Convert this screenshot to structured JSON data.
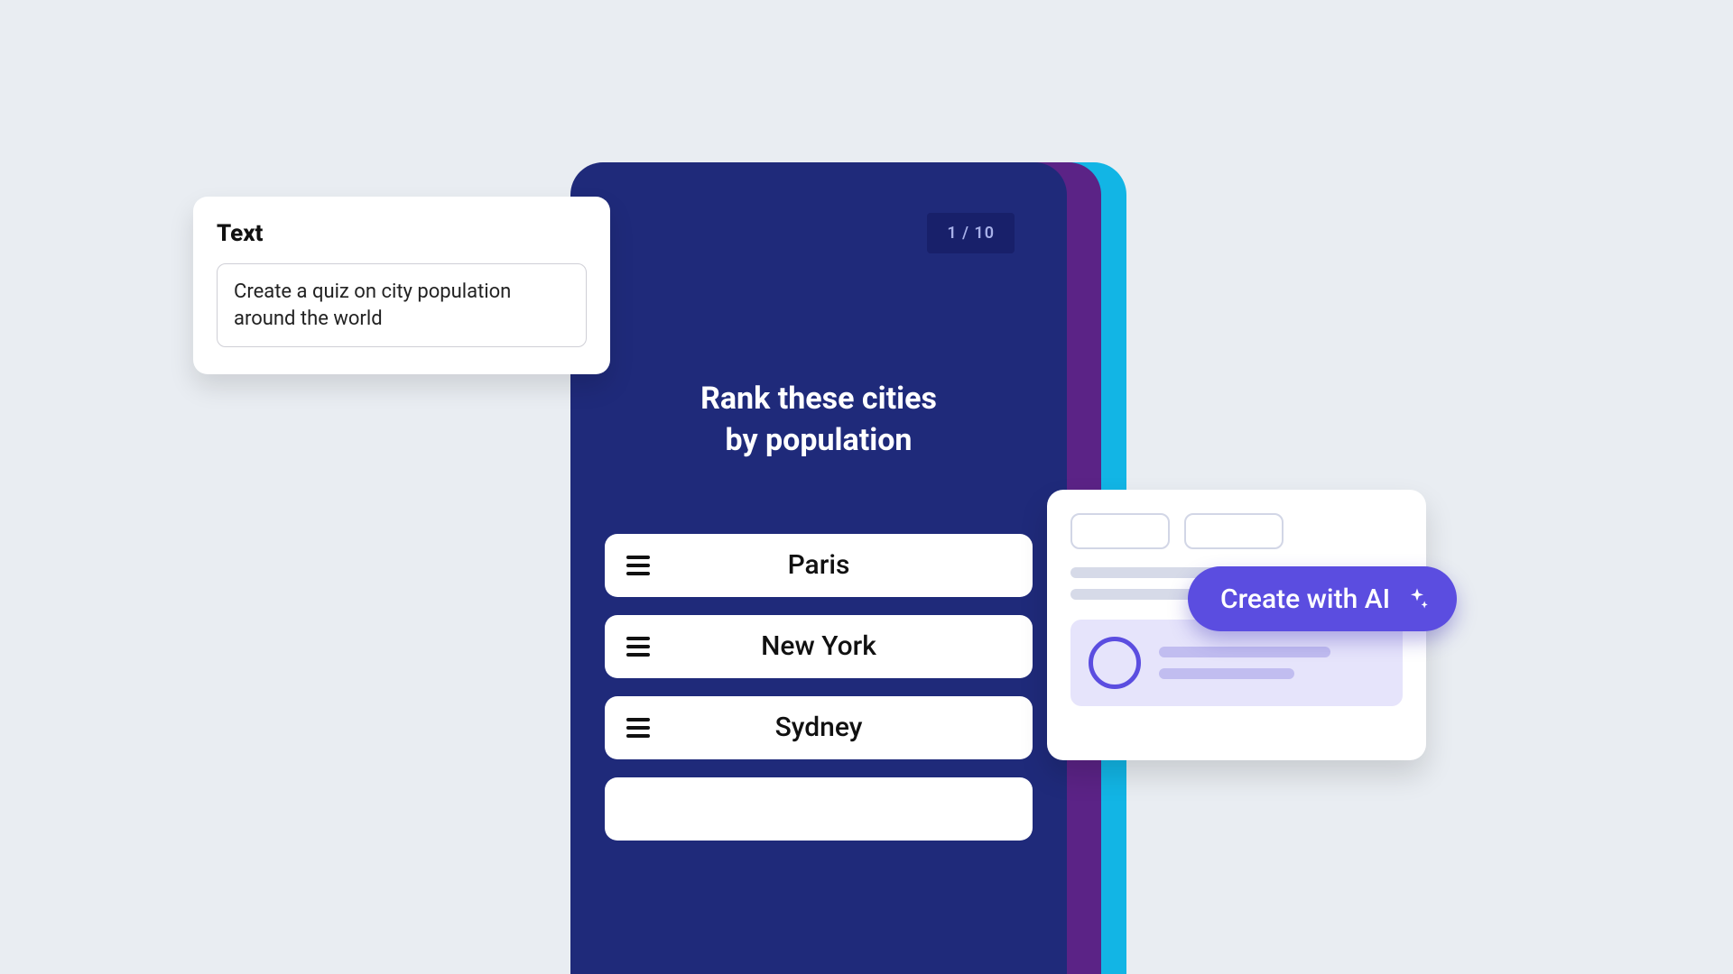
{
  "text_card": {
    "title": "Text",
    "input_value": "Create a quiz on city population around the world"
  },
  "phone": {
    "progress_label": "1 / 10",
    "question": "Rank these cities by population",
    "options": [
      "Paris",
      "New York",
      "Sydney",
      ""
    ]
  },
  "create_ai_button": {
    "label": "Create with AI"
  }
}
